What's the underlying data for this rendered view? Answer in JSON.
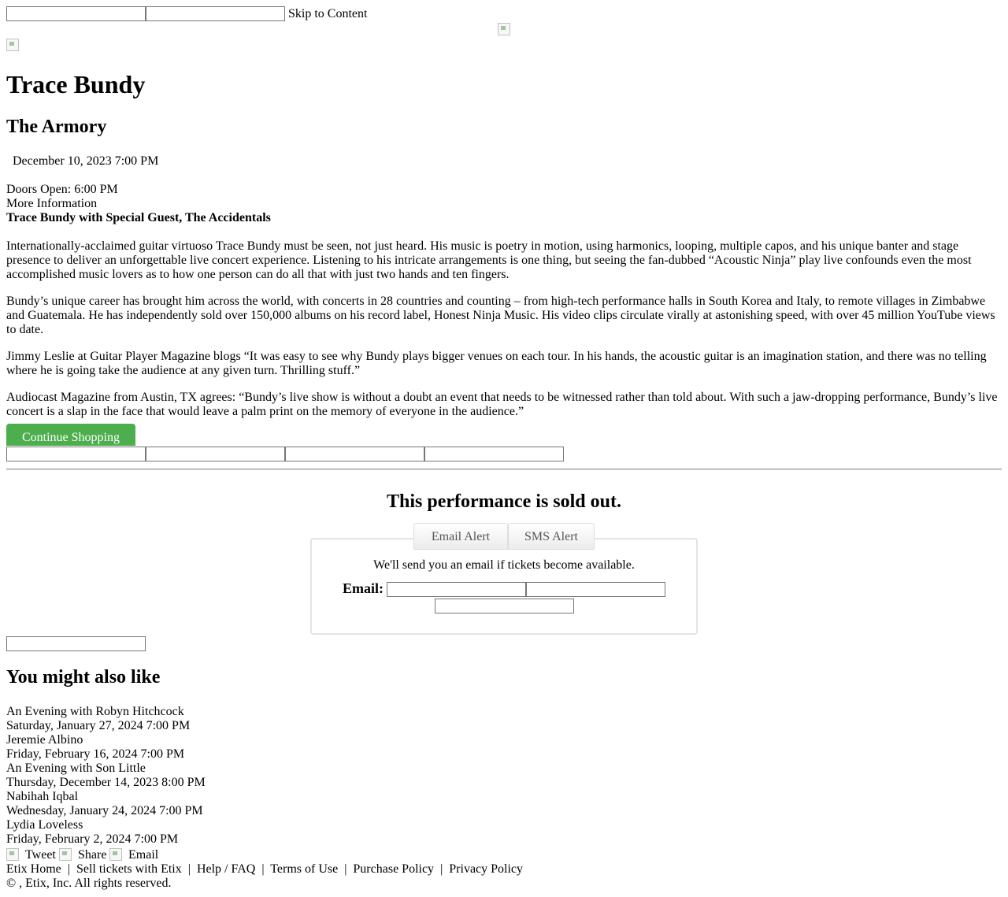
{
  "top": {
    "skip_link": "Skip to Content"
  },
  "event": {
    "title": "Trace Bundy",
    "venue": "The Armory",
    "datetime": "December 10, 2023 7:00 PM",
    "doors": "Doors Open: 6:00 PM",
    "more_info": "More Information",
    "subtitle": "Trace Bundy with Special Guest, The Accidentals",
    "paragraphs": [
      "Internationally-acclaimed guitar virtuoso Trace Bundy must be seen, not just heard. His music is poetry in motion, using harmonics, looping, multiple capos, and his unique banter and stage presence to deliver an unforgettable live concert experience. Listening to his intricate arrangements is one thing, but seeing the fan-dubbed “Acoustic Ninja” play live confounds even the most accomplished music lovers as to how one person can do all that with just two hands and ten fingers.",
      "Bundy’s unique career has brought him across the world, with concerts in 28 countries and counting – from high-tech performance halls in South Korea and Italy, to remote villages in Zimbabwe and Guatemala. He has independently sold over 150,000 albums on his record label, Honest Ninja Music. His video clips circulate virally at astonishing speed, with over 45 million YouTube views to date.",
      "Jimmy Leslie at Guitar Player Magazine blogs “It was easy to see why Bundy plays bigger venues on each tour. In his hands, the acoustic guitar is an imagination station, and there was no telling where he is going take the audience at any given turn. Thrilling stuff.”",
      "Audiocast Magazine from Austin, TX agrees: “Bundy’s live show is without a doubt an event that needs to be witnessed rather than told about. With such a jaw-dropping performance, Bundy’s live concert is a slap in the face that would leave a palm print on the memory of everyone in the audience.”"
    ],
    "continue_shopping": "Continue Shopping"
  },
  "soldout": {
    "heading": "This performance is sold out.",
    "tabs": [
      "Email Alert",
      "SMS Alert"
    ],
    "message": "We'll send you an email if tickets become available.",
    "email_label": "Email:"
  },
  "related": {
    "heading": "You might also like",
    "items": [
      {
        "name": "An Evening with Robyn Hitchcock",
        "date": "Saturday, January 27, 2024 7:00 PM"
      },
      {
        "name": "Jeremie Albino",
        "date": "Friday, February 16, 2024 7:00 PM"
      },
      {
        "name": "An Evening with Son Little",
        "date": "Thursday, December 14, 2023 8:00 PM"
      },
      {
        "name": "Nabihah Iqbal",
        "date": "Wednesday, January 24, 2024 7:00 PM"
      },
      {
        "name": "Lydia Loveless",
        "date": "Friday, February 2, 2024 7:00 PM"
      }
    ]
  },
  "social": {
    "tweet": "Tweet",
    "share": "Share",
    "email": "Email"
  },
  "footer": {
    "links": [
      "Etix Home",
      "Sell tickets with Etix",
      "Help / FAQ",
      "Terms of Use",
      "Purchase Policy",
      "Privacy Policy"
    ],
    "separator": "|",
    "copyright": "© , Etix, Inc. All rights reserved."
  }
}
